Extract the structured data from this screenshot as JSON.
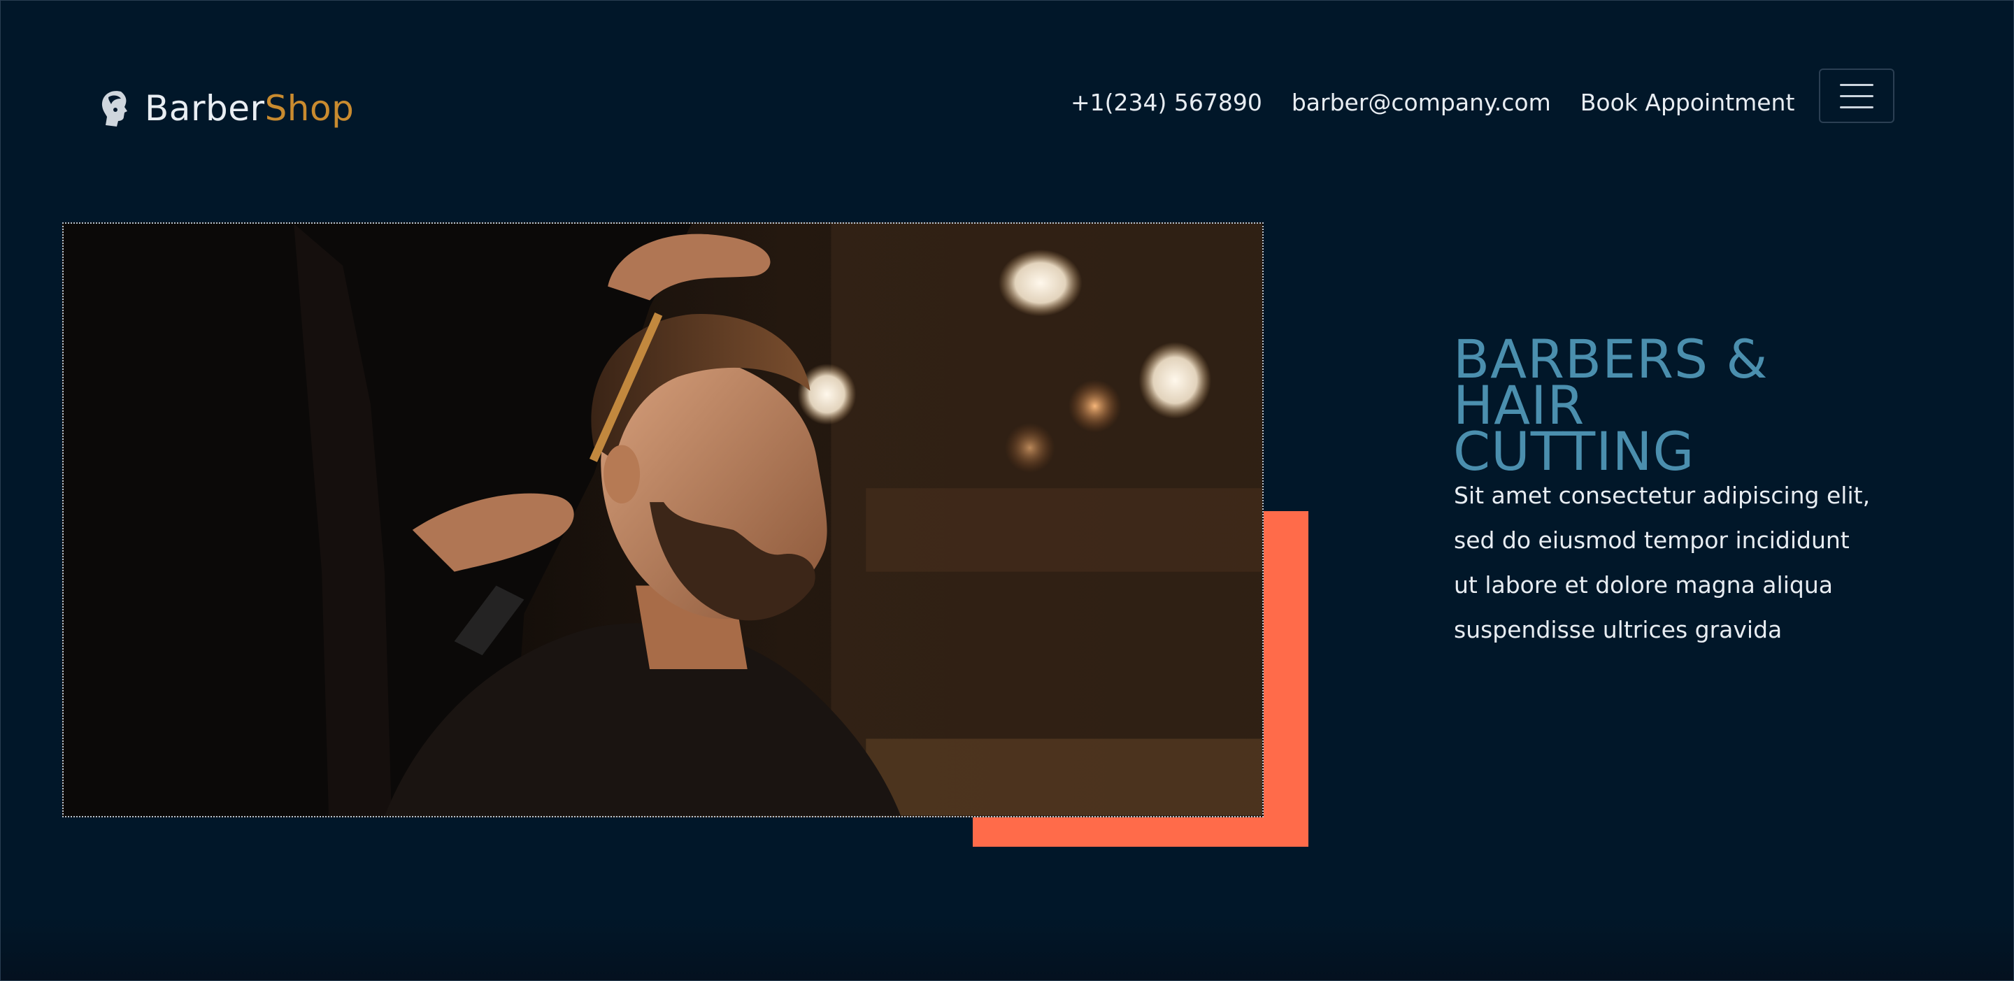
{
  "brand": {
    "name_part1": "Barber",
    "name_part2": "Shop",
    "icon": "barber-head-icon",
    "accent_color": "#c98b2f"
  },
  "nav": {
    "phone": "+1(234) 567890",
    "email": "barber@company.com",
    "book": "Book Appointment",
    "menu_icon": "hamburger-menu-icon"
  },
  "hero": {
    "image": "barber-cutting-hair-photo",
    "accent_color": "#ff6b4a"
  },
  "headline": {
    "line1": "BARBERS &",
    "line2": "HAIR",
    "line3": "CUTTING",
    "color": "#4b8fae"
  },
  "body": {
    "text": "Sit amet consectetur adipiscing elit, sed do eiusmod tempor incididunt ut labore et dolore magna aliqua suspendisse ultrices gravida"
  }
}
